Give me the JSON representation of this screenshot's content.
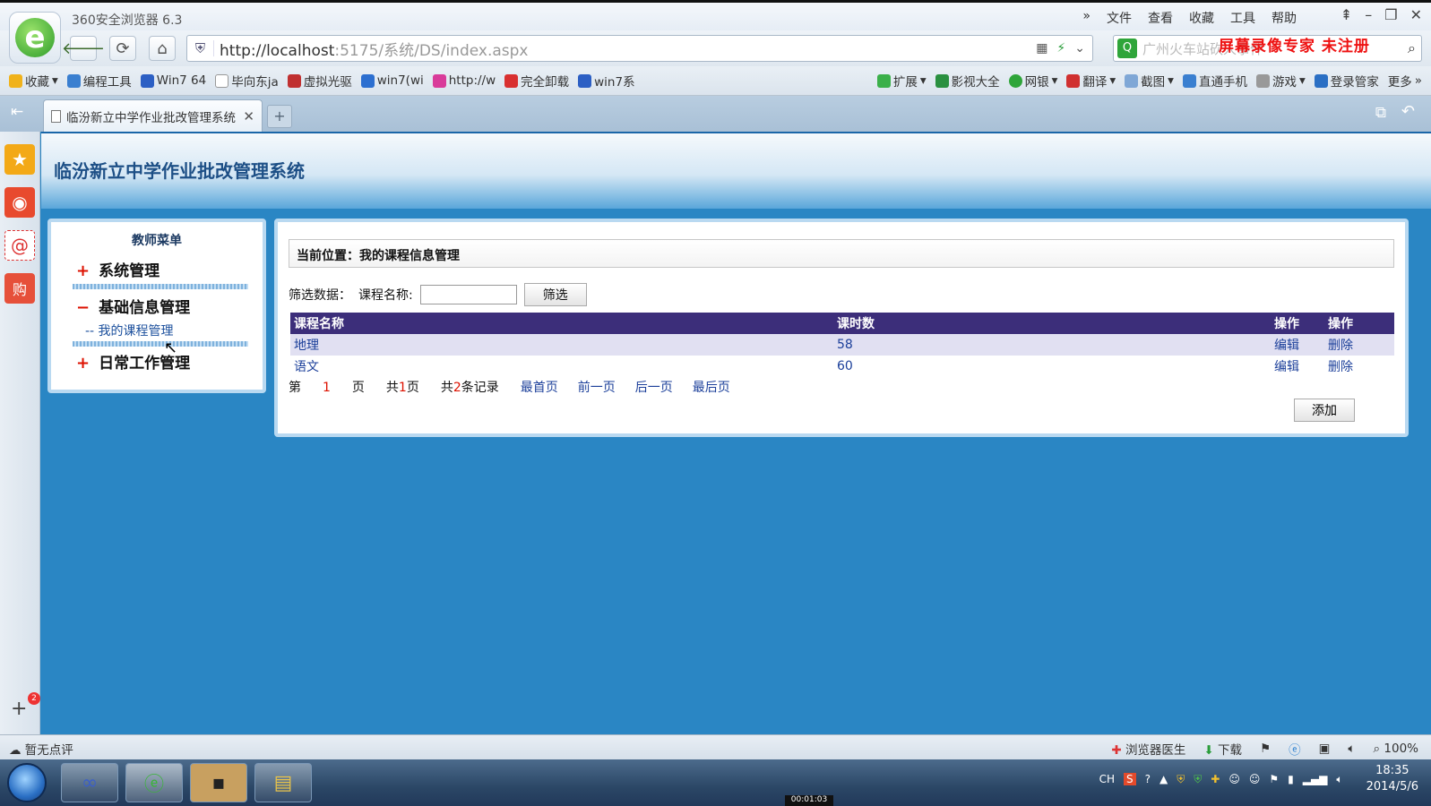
{
  "browser": {
    "title": "360安全浏览器 6.3",
    "menu": [
      "»",
      "文件",
      "查看",
      "收藏",
      "工具",
      "帮助"
    ],
    "window_controls": [
      "⇞",
      "–",
      "❐",
      "✕"
    ],
    "url_host": "http://localhost",
    "url_path": ":5175/系统/DS/index.aspx",
    "search_placeholder": "广州火车站砍人事件",
    "watermark": "屏幕录像专家  未注册",
    "bookmarks": [
      "收藏",
      "编程工具",
      "Win7 64",
      "毕向东ja",
      "虚拟光驱",
      "win7(wi",
      "http://w",
      "完全卸载",
      "win7系"
    ],
    "toolbar_right": [
      "扩展",
      "影视大全",
      "网银",
      "翻译",
      "截图",
      "直通手机",
      "游戏",
      "登录管家",
      "更多"
    ],
    "tab_title": "临汾新立中学作业批改管理系统",
    "status_left": "暂无点评",
    "status_right": [
      "浏览器医生",
      "下载",
      "100%"
    ],
    "sidebar_badge": "2"
  },
  "page": {
    "system_title": "临汾新立中学作业批改管理系统",
    "menu_title": "教师菜单",
    "menu_groups": [
      {
        "sign": "+",
        "label": "系统管理"
      },
      {
        "sign": "−",
        "label": "基础信息管理"
      },
      {
        "sign": "+",
        "label": "日常工作管理"
      }
    ],
    "menu_sub": "-- 我的课程管理",
    "location": "当前位置：我的课程信息管理",
    "filter_label": "筛选数据：",
    "filter_field": "课程名称:",
    "filter_value": "",
    "filter_button": "筛选",
    "columns": [
      "课程名称",
      "课时数",
      "操作",
      "操作"
    ],
    "rows": [
      {
        "name": "地理",
        "hours": "58",
        "edit": "编辑",
        "del": "删除"
      },
      {
        "name": "语文",
        "hours": "60",
        "edit": "编辑",
        "del": "删除"
      }
    ],
    "pager": {
      "page_prefix": "第",
      "page_no": "1",
      "page_suffix": "页",
      "total_prefix": "共",
      "total_pages": "1",
      "total_suffix": "页",
      "rec_prefix": "共",
      "records": "2",
      "rec_suffix": "条记录",
      "first": "最首页",
      "prev": "前一页",
      "next": "后一页",
      "last": "最后页"
    },
    "add_button": "添加"
  },
  "taskbar": {
    "ime": "CH",
    "time": "18:35",
    "date": "2014/5/6",
    "recorder_time": "00:01:03"
  },
  "colors": {
    "accent": "#2a86c4",
    "grid_header": "#3c2e7a",
    "link": "#1b3f9a",
    "watermark": "#e11111"
  }
}
